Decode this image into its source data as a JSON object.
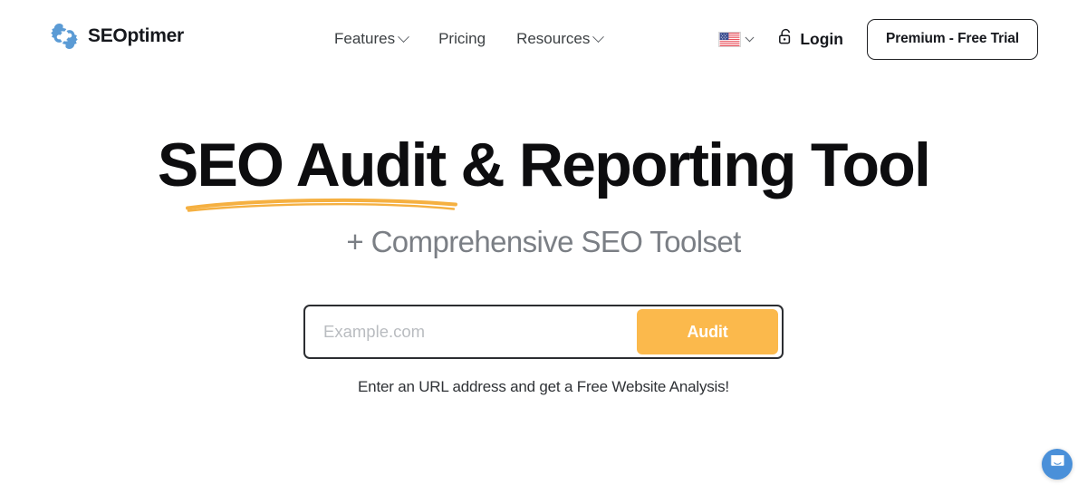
{
  "brand": {
    "name": "SEOptimer",
    "logo_icon": "gear-s-logo-icon",
    "logo_color": "#5b9bd5"
  },
  "nav": {
    "items": [
      {
        "label": "Features",
        "has_dropdown": true
      },
      {
        "label": "Pricing",
        "has_dropdown": false
      },
      {
        "label": "Resources",
        "has_dropdown": true
      }
    ]
  },
  "header_right": {
    "language": {
      "icon": "us-flag-icon",
      "has_dropdown": true
    },
    "login": {
      "icon": "lock-icon",
      "label": "Login"
    },
    "premium_button": {
      "label": "Premium - Free Trial"
    }
  },
  "hero": {
    "headline": "SEO Audit & Reporting Tool",
    "headline_underline_color": "#f5b041",
    "subheadline": "+ Comprehensive SEO Toolset"
  },
  "audit_form": {
    "input_placeholder": "Example.com",
    "input_value": "",
    "submit_label": "Audit",
    "submit_color": "#fbb94c",
    "hint": "Enter an URL address and get a Free Website Analysis!"
  },
  "chat": {
    "icon": "chat-bubble-icon",
    "color": "#4a90d9"
  }
}
